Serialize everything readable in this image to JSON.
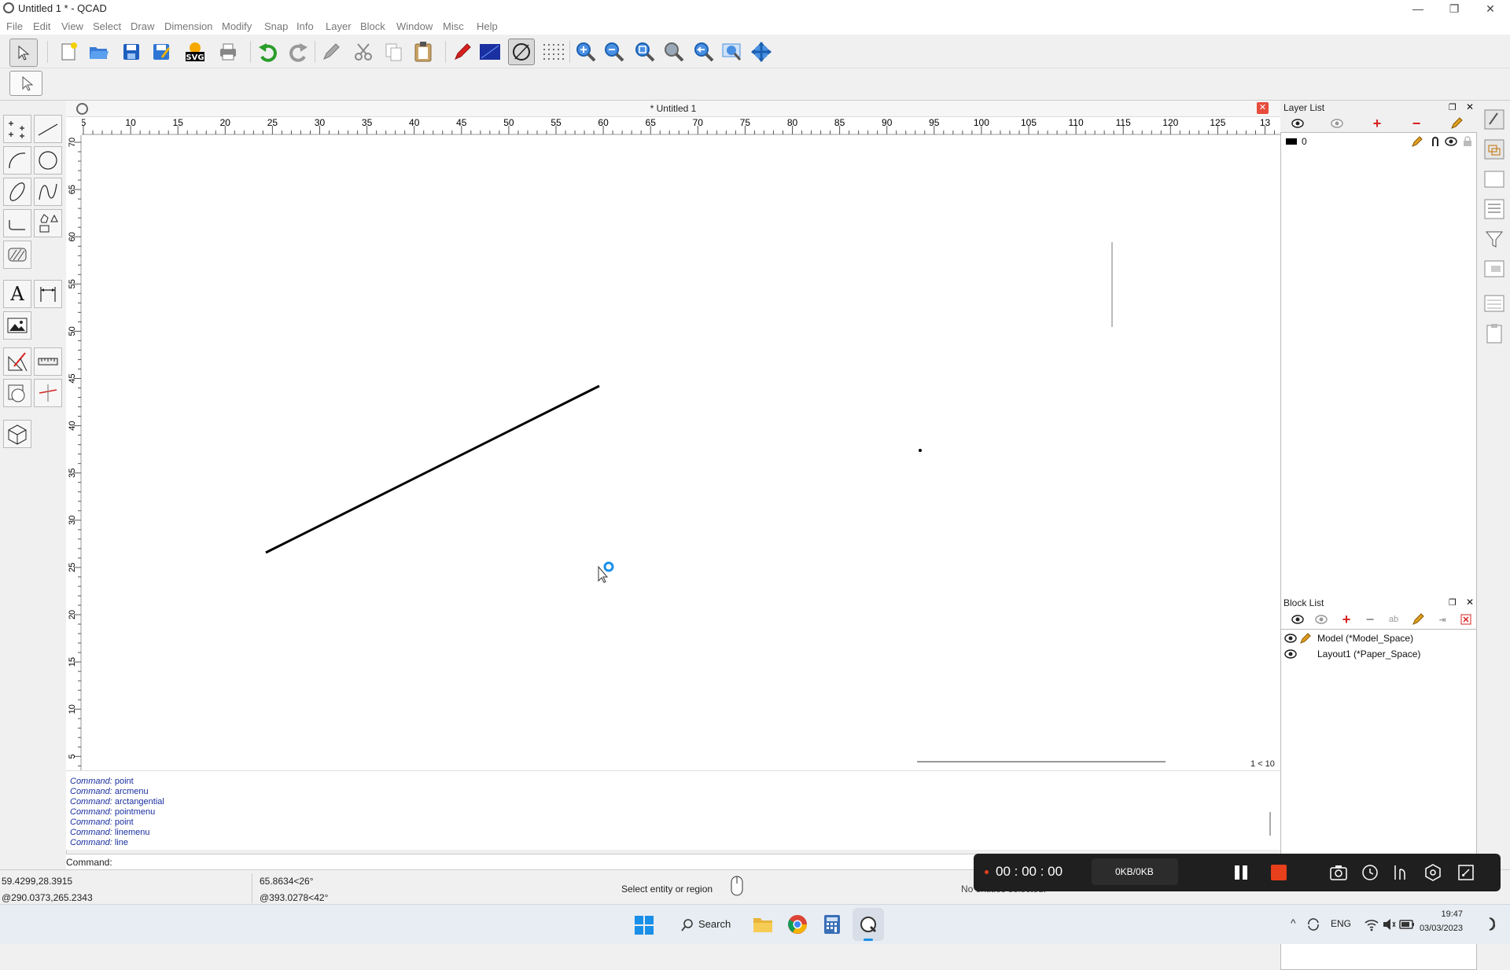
{
  "window": {
    "title": "Untitled 1 * - QCAD",
    "minimize": "—",
    "maximize": "❐",
    "close": "✕"
  },
  "menu": [
    "File",
    "Edit",
    "View",
    "Select",
    "Draw",
    "Dimension",
    "Modify",
    "Snap",
    "Info",
    "Layer",
    "Block",
    "Window",
    "Misc",
    "Help"
  ],
  "toolbar": {
    "svg_label": "SVG",
    "icons": [
      "select-arrow-icon",
      "new-file-icon",
      "open-folder-icon",
      "save-icon",
      "save-as-icon",
      "svg-export-icon",
      "print-preview-icon",
      "undo-icon",
      "redo-icon",
      "pencil-icon",
      "cut-icon",
      "copy-icon",
      "paste-icon",
      "red-pen-icon",
      "blue-square-icon",
      "circle-slash-icon",
      "grid-icon",
      "zoom-in-icon",
      "zoom-out-icon",
      "zoom-auto-icon",
      "zoom-window-icon",
      "zoom-previous-icon",
      "zoom-selection-icon",
      "pan-icon"
    ]
  },
  "drawing": {
    "title": "* Untitled 1",
    "hruler_labels": [
      "5",
      "10",
      "15",
      "20",
      "25",
      "30",
      "35",
      "40",
      "45",
      "50",
      "55",
      "60",
      "65",
      "70",
      "75",
      "80",
      "85",
      "90",
      "95",
      "100",
      "105",
      "110",
      "115",
      "120",
      "125",
      "13"
    ],
    "vruler_labels": [
      "70",
      "65",
      "60",
      "55",
      "50",
      "45",
      "40",
      "35",
      "30",
      "25",
      "20",
      "15",
      "10",
      "5"
    ],
    "zoom_scale": "1 < 10"
  },
  "palette": {
    "text_tool_glyph": "A"
  },
  "command_history": [
    {
      "label": "Command:",
      "value": "point"
    },
    {
      "label": "Command:",
      "value": "arcmenu"
    },
    {
      "label": "Command:",
      "value": "arctangential"
    },
    {
      "label": "Command:",
      "value": "pointmenu"
    },
    {
      "label": "Command:",
      "value": "point"
    },
    {
      "label": "Command:",
      "value": "linemenu"
    },
    {
      "label": "Command:",
      "value": "line"
    }
  ],
  "command_input": {
    "label": "Command:"
  },
  "layer_list": {
    "title": "Layer List",
    "layers": [
      {
        "name": "0",
        "color": "#000000"
      }
    ]
  },
  "block_list": {
    "title": "Block List",
    "rename_label": "ab",
    "blocks": [
      {
        "name": "Model (*Model_Space)"
      },
      {
        "name": "Layout1 (*Paper_Space)"
      }
    ]
  },
  "status": {
    "abs_coord": "59.4299,28.3915",
    "rel_coord": "@290.0373,265.2343",
    "polar_coord": "65.8634<26°",
    "rel_polar": "@393.0278<42°",
    "prompt": "Select entity or region",
    "selection": "No entities selected."
  },
  "recorder": {
    "time": "00 : 00 : 00",
    "size": "0KB/0KB"
  },
  "taskbar": {
    "search": "Search",
    "lang": "ENG",
    "time": "19:47",
    "date": "03/03/2023"
  },
  "colors": {
    "accent_blue": "#1a6fd6",
    "recorder_stop": "#e8401c",
    "close_red": "#e74c3c"
  }
}
